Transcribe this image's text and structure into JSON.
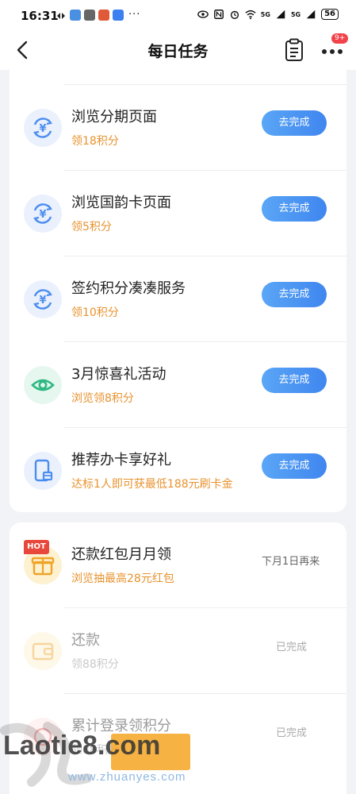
{
  "status_bar": {
    "time": "16:31",
    "battery": "56",
    "signal_1": "5G",
    "signal_2": "5G",
    "more": "···"
  },
  "header": {
    "title": "每日任务",
    "badge": "9+"
  },
  "tasks": [
    {
      "title": "浏览分期页面",
      "reward": "领18积分",
      "action": "去完成",
      "icon": "yuan-exchange-icon"
    },
    {
      "title": "浏览国韵卡页面",
      "reward": "领5积分",
      "action": "去完成",
      "icon": "yuan-exchange-icon"
    },
    {
      "title": "签约积分凑凑服务",
      "reward": "领10积分",
      "action": "去完成",
      "icon": "yuan-exchange-icon"
    },
    {
      "title": "3月惊喜礼活动",
      "reward": "浏览领8积分",
      "action": "去完成",
      "icon": "eye-icon"
    },
    {
      "title": "推荐办卡享好礼",
      "reward": "达标1人即可获最低188元刷卡金",
      "action": "去完成",
      "icon": "card-gift-icon"
    }
  ],
  "tasks2": [
    {
      "title": "还款红包月月领",
      "reward": "浏览抽最高28元红包",
      "status": "下月1日再来",
      "hot": "HOT",
      "icon": "gift-icon"
    },
    {
      "title": "还款",
      "reward": "领88积分",
      "status": "已完成",
      "icon": "wallet-icon"
    },
    {
      "title": "累计登录领积分",
      "reward": "领88积分",
      "status": "已完成",
      "icon": "login-icon"
    }
  ],
  "watermark": {
    "brand": "Laotie8.com",
    "sub": "www.zhuanyes.com"
  },
  "colors": {
    "accent_blue": "#3f86ef",
    "reward_orange": "#e8922e",
    "hot_red": "#e8473c",
    "badge_red": "#f2434b"
  }
}
